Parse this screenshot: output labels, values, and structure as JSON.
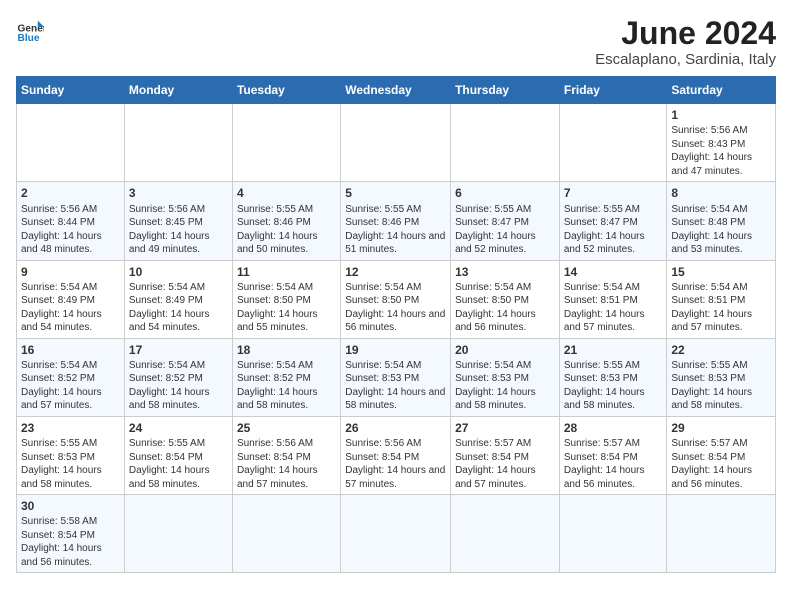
{
  "header": {
    "logo_general": "General",
    "logo_blue": "Blue",
    "month_title": "June 2024",
    "subtitle": "Escalaplano, Sardinia, Italy"
  },
  "days_of_week": [
    "Sunday",
    "Monday",
    "Tuesday",
    "Wednesday",
    "Thursday",
    "Friday",
    "Saturday"
  ],
  "weeks": [
    [
      {
        "day": "",
        "sunrise": "",
        "sunset": "",
        "daylight": ""
      },
      {
        "day": "",
        "sunrise": "",
        "sunset": "",
        "daylight": ""
      },
      {
        "day": "",
        "sunrise": "",
        "sunset": "",
        "daylight": ""
      },
      {
        "day": "",
        "sunrise": "",
        "sunset": "",
        "daylight": ""
      },
      {
        "day": "",
        "sunrise": "",
        "sunset": "",
        "daylight": ""
      },
      {
        "day": "",
        "sunrise": "",
        "sunset": "",
        "daylight": ""
      },
      {
        "day": "1",
        "sunrise": "Sunrise: 5:56 AM",
        "sunset": "Sunset: 8:43 PM",
        "daylight": "Daylight: 14 hours and 47 minutes."
      }
    ],
    [
      {
        "day": "2",
        "sunrise": "Sunrise: 5:56 AM",
        "sunset": "Sunset: 8:44 PM",
        "daylight": "Daylight: 14 hours and 48 minutes."
      },
      {
        "day": "3",
        "sunrise": "Sunrise: 5:56 AM",
        "sunset": "Sunset: 8:45 PM",
        "daylight": "Daylight: 14 hours and 49 minutes."
      },
      {
        "day": "4",
        "sunrise": "Sunrise: 5:55 AM",
        "sunset": "Sunset: 8:46 PM",
        "daylight": "Daylight: 14 hours and 50 minutes."
      },
      {
        "day": "5",
        "sunrise": "Sunrise: 5:55 AM",
        "sunset": "Sunset: 8:46 PM",
        "daylight": "Daylight: 14 hours and 51 minutes."
      },
      {
        "day": "6",
        "sunrise": "Sunrise: 5:55 AM",
        "sunset": "Sunset: 8:47 PM",
        "daylight": "Daylight: 14 hours and 52 minutes."
      },
      {
        "day": "7",
        "sunrise": "Sunrise: 5:55 AM",
        "sunset": "Sunset: 8:47 PM",
        "daylight": "Daylight: 14 hours and 52 minutes."
      },
      {
        "day": "8",
        "sunrise": "Sunrise: 5:54 AM",
        "sunset": "Sunset: 8:48 PM",
        "daylight": "Daylight: 14 hours and 53 minutes."
      }
    ],
    [
      {
        "day": "9",
        "sunrise": "Sunrise: 5:54 AM",
        "sunset": "Sunset: 8:49 PM",
        "daylight": "Daylight: 14 hours and 54 minutes."
      },
      {
        "day": "10",
        "sunrise": "Sunrise: 5:54 AM",
        "sunset": "Sunset: 8:49 PM",
        "daylight": "Daylight: 14 hours and 54 minutes."
      },
      {
        "day": "11",
        "sunrise": "Sunrise: 5:54 AM",
        "sunset": "Sunset: 8:50 PM",
        "daylight": "Daylight: 14 hours and 55 minutes."
      },
      {
        "day": "12",
        "sunrise": "Sunrise: 5:54 AM",
        "sunset": "Sunset: 8:50 PM",
        "daylight": "Daylight: 14 hours and 56 minutes."
      },
      {
        "day": "13",
        "sunrise": "Sunrise: 5:54 AM",
        "sunset": "Sunset: 8:50 PM",
        "daylight": "Daylight: 14 hours and 56 minutes."
      },
      {
        "day": "14",
        "sunrise": "Sunrise: 5:54 AM",
        "sunset": "Sunset: 8:51 PM",
        "daylight": "Daylight: 14 hours and 57 minutes."
      },
      {
        "day": "15",
        "sunrise": "Sunrise: 5:54 AM",
        "sunset": "Sunset: 8:51 PM",
        "daylight": "Daylight: 14 hours and 57 minutes."
      }
    ],
    [
      {
        "day": "16",
        "sunrise": "Sunrise: 5:54 AM",
        "sunset": "Sunset: 8:52 PM",
        "daylight": "Daylight: 14 hours and 57 minutes."
      },
      {
        "day": "17",
        "sunrise": "Sunrise: 5:54 AM",
        "sunset": "Sunset: 8:52 PM",
        "daylight": "Daylight: 14 hours and 58 minutes."
      },
      {
        "day": "18",
        "sunrise": "Sunrise: 5:54 AM",
        "sunset": "Sunset: 8:52 PM",
        "daylight": "Daylight: 14 hours and 58 minutes."
      },
      {
        "day": "19",
        "sunrise": "Sunrise: 5:54 AM",
        "sunset": "Sunset: 8:53 PM",
        "daylight": "Daylight: 14 hours and 58 minutes."
      },
      {
        "day": "20",
        "sunrise": "Sunrise: 5:54 AM",
        "sunset": "Sunset: 8:53 PM",
        "daylight": "Daylight: 14 hours and 58 minutes."
      },
      {
        "day": "21",
        "sunrise": "Sunrise: 5:55 AM",
        "sunset": "Sunset: 8:53 PM",
        "daylight": "Daylight: 14 hours and 58 minutes."
      },
      {
        "day": "22",
        "sunrise": "Sunrise: 5:55 AM",
        "sunset": "Sunset: 8:53 PM",
        "daylight": "Daylight: 14 hours and 58 minutes."
      }
    ],
    [
      {
        "day": "23",
        "sunrise": "Sunrise: 5:55 AM",
        "sunset": "Sunset: 8:53 PM",
        "daylight": "Daylight: 14 hours and 58 minutes."
      },
      {
        "day": "24",
        "sunrise": "Sunrise: 5:55 AM",
        "sunset": "Sunset: 8:54 PM",
        "daylight": "Daylight: 14 hours and 58 minutes."
      },
      {
        "day": "25",
        "sunrise": "Sunrise: 5:56 AM",
        "sunset": "Sunset: 8:54 PM",
        "daylight": "Daylight: 14 hours and 57 minutes."
      },
      {
        "day": "26",
        "sunrise": "Sunrise: 5:56 AM",
        "sunset": "Sunset: 8:54 PM",
        "daylight": "Daylight: 14 hours and 57 minutes."
      },
      {
        "day": "27",
        "sunrise": "Sunrise: 5:57 AM",
        "sunset": "Sunset: 8:54 PM",
        "daylight": "Daylight: 14 hours and 57 minutes."
      },
      {
        "day": "28",
        "sunrise": "Sunrise: 5:57 AM",
        "sunset": "Sunset: 8:54 PM",
        "daylight": "Daylight: 14 hours and 56 minutes."
      },
      {
        "day": "29",
        "sunrise": "Sunrise: 5:57 AM",
        "sunset": "Sunset: 8:54 PM",
        "daylight": "Daylight: 14 hours and 56 minutes."
      }
    ],
    [
      {
        "day": "30",
        "sunrise": "Sunrise: 5:58 AM",
        "sunset": "Sunset: 8:54 PM",
        "daylight": "Daylight: 14 hours and 56 minutes."
      },
      {
        "day": "",
        "sunrise": "",
        "sunset": "",
        "daylight": ""
      },
      {
        "day": "",
        "sunrise": "",
        "sunset": "",
        "daylight": ""
      },
      {
        "day": "",
        "sunrise": "",
        "sunset": "",
        "daylight": ""
      },
      {
        "day": "",
        "sunrise": "",
        "sunset": "",
        "daylight": ""
      },
      {
        "day": "",
        "sunrise": "",
        "sunset": "",
        "daylight": ""
      },
      {
        "day": "",
        "sunrise": "",
        "sunset": "",
        "daylight": ""
      }
    ]
  ]
}
